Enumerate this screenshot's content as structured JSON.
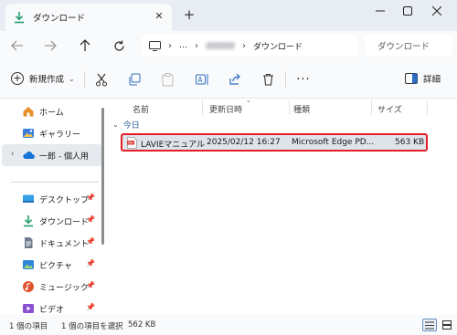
{
  "tab": {
    "title": "ダウンロード",
    "icon": "download-icon"
  },
  "address": {
    "breadcrumb": [
      "…",
      "ダウンロード"
    ]
  },
  "search": {
    "placeholder": "ダウンロード の検索",
    "display": "ダウンロード"
  },
  "toolbar": {
    "new_label": "新規作成",
    "details_label": "詳細"
  },
  "sidebar": {
    "items": [
      {
        "label": "ホーム",
        "icon": "home-icon"
      },
      {
        "label": "ギャラリー",
        "icon": "gallery-icon"
      },
      {
        "label": "一郎 - 個人用",
        "icon": "onedrive-cloud-icon"
      },
      {
        "label": "デスクトップ",
        "icon": "desktop-icon"
      },
      {
        "label": "ダウンロード",
        "icon": "download-icon"
      },
      {
        "label": "ドキュメント",
        "icon": "documents-icon"
      },
      {
        "label": "ピクチャ",
        "icon": "pictures-icon"
      },
      {
        "label": "ミュージック",
        "icon": "music-icon"
      },
      {
        "label": "ビデオ",
        "icon": "video-icon"
      }
    ]
  },
  "columns": {
    "name": "名前",
    "date": "更新日時",
    "type": "種類",
    "size": "サイズ"
  },
  "group": {
    "label": "今日"
  },
  "files": [
    {
      "name": "LAVIEマニュアル",
      "date": "2025/02/12 16:27",
      "type": "Microsoft Edge PD...",
      "size": "563 KB",
      "icon": "pdf-file-icon"
    }
  ],
  "status": {
    "count": "1 個の項目",
    "selected": "1 個の項目を選択",
    "size": "562 KB"
  },
  "colors": {
    "highlight_border": "#e51d24",
    "accent": "#2d6cc0",
    "selected_row": "#dfe3ea"
  }
}
